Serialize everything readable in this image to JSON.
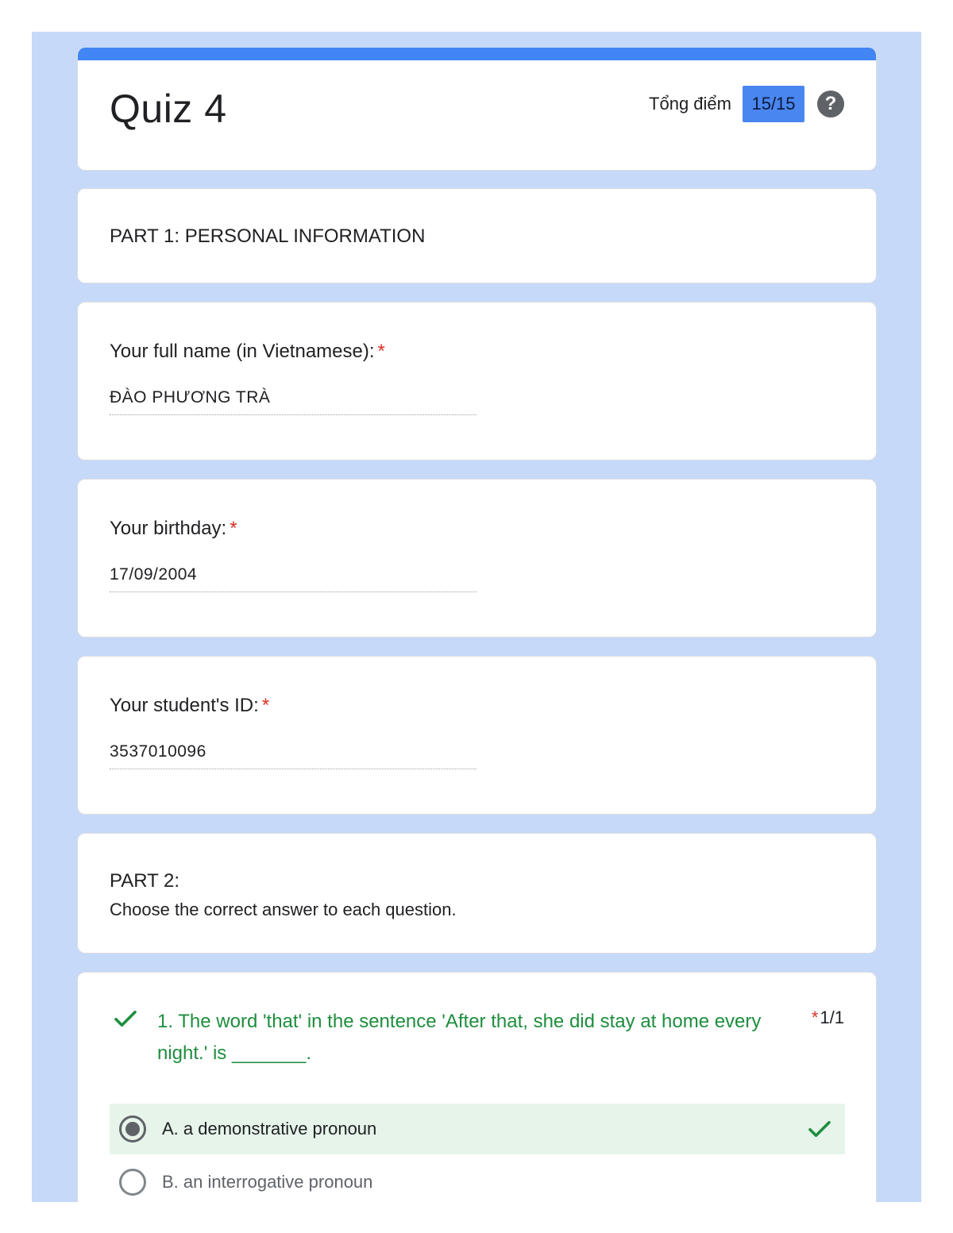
{
  "header": {
    "title": "Quiz 4",
    "score_label": "Tổng điểm",
    "score_value": "15/15",
    "help_icon": "help-circle-icon"
  },
  "part1": {
    "title": "PART 1: PERSONAL INFORMATION"
  },
  "questions_personal": [
    {
      "label": "Your full name (in Vietnamese):",
      "required_mark": "*",
      "value": "ĐÀO PHƯƠNG TRÀ"
    },
    {
      "label": "Your birthday:",
      "required_mark": "*",
      "value": "17/09/2004"
    },
    {
      "label": "Your student's ID:",
      "required_mark": "*",
      "value": "3537010096"
    }
  ],
  "part2": {
    "title": "PART 2:",
    "description": "Choose the correct answer to each question."
  },
  "question1": {
    "text": "1. The word 'that' in the sentence 'After that, she did stay at home every night.' is _______.",
    "required_mark": "*",
    "points": "1/1",
    "status_icon": "check-icon",
    "options": [
      {
        "label": "A. a demonstrative pronoun",
        "selected": true,
        "correct": true
      },
      {
        "label": "B. an interrogative pronoun",
        "selected": false,
        "correct": false
      }
    ]
  },
  "colors": {
    "background": "#c6d9f9",
    "accent": "#4285f4",
    "correct": "#1e8e3e",
    "required": "#d93025"
  }
}
